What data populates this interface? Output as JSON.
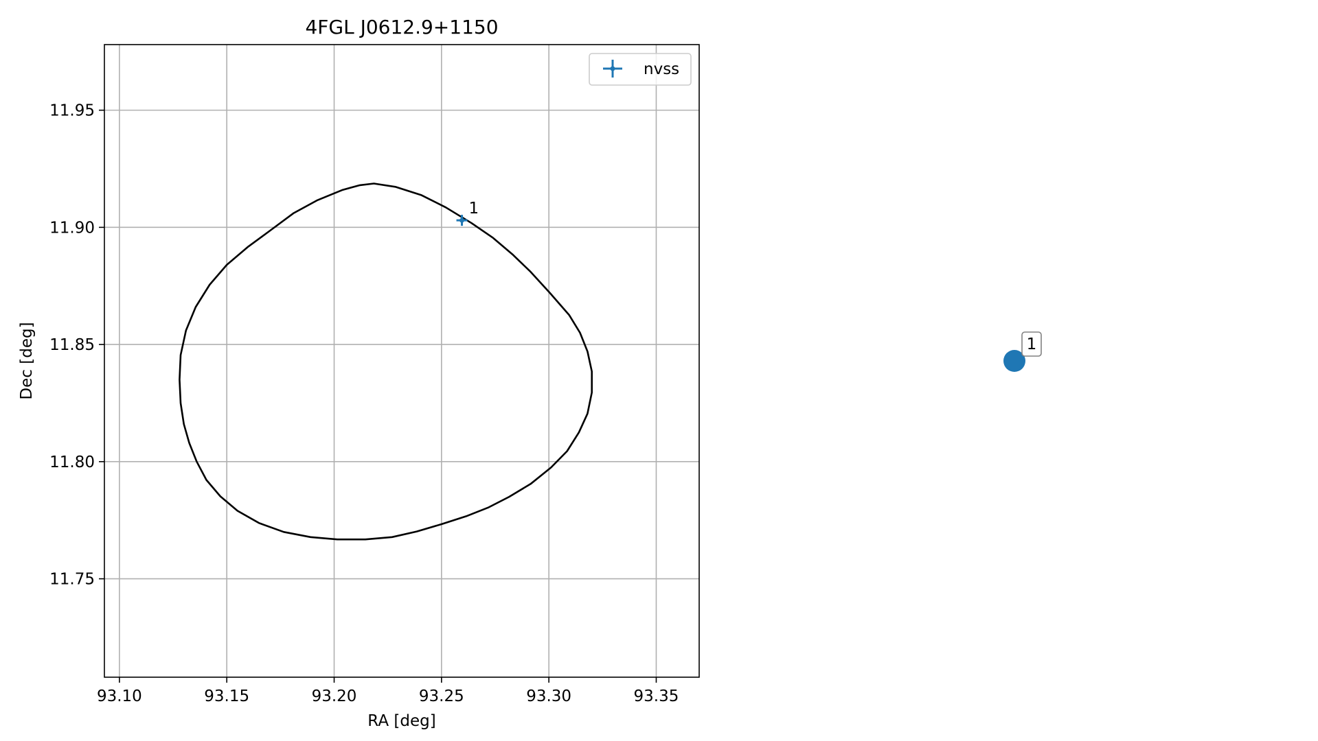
{
  "chart_data": [
    {
      "type": "scatter",
      "title": "4FGL J0612.9+1150",
      "xlabel": "RA [deg]",
      "ylabel": "Dec [deg]",
      "xlim": [
        93.093,
        93.37
      ],
      "ylim": [
        11.708,
        11.978
      ],
      "xticks": [
        93.1,
        93.15,
        93.2,
        93.25,
        93.3,
        93.35
      ],
      "xtick_labels": [
        "93.10",
        "93.15",
        "93.20",
        "93.25",
        "93.30",
        "93.35"
      ],
      "yticks": [
        11.75,
        11.8,
        11.85,
        11.9,
        11.95
      ],
      "ytick_labels": [
        "11.75",
        "11.80",
        "11.85",
        "11.90",
        "11.95"
      ],
      "grid": true,
      "legend": {
        "position": "top-right",
        "entries": [
          {
            "label": "nvss",
            "color": "#1f77b4",
            "marker": "errorbar-plus"
          }
        ]
      },
      "series": [
        {
          "name": "nvss",
          "color": "#1f77b4",
          "points": [
            {
              "x": 93.2595,
              "y": 11.903,
              "label": "1"
            }
          ]
        }
      ],
      "ellipse": {
        "color": "#000000",
        "points": [
          [
            93.2185,
            11.9187
          ],
          [
            93.2285,
            11.9173
          ],
          [
            93.2405,
            11.9138
          ],
          [
            93.252,
            11.9085
          ],
          [
            93.264,
            11.9018
          ],
          [
            93.274,
            11.8955
          ],
          [
            93.283,
            11.8885
          ],
          [
            93.2915,
            11.881
          ],
          [
            93.3005,
            11.872
          ],
          [
            93.3095,
            11.8625
          ],
          [
            93.3145,
            11.855
          ],
          [
            93.318,
            11.847
          ],
          [
            93.32,
            11.8385
          ],
          [
            93.32,
            11.8295
          ],
          [
            93.318,
            11.8205
          ],
          [
            93.314,
            11.8125
          ],
          [
            93.3085,
            11.8045
          ],
          [
            93.301,
            11.7975
          ],
          [
            93.2915,
            11.7905
          ],
          [
            93.2815,
            11.785
          ],
          [
            93.272,
            11.7805
          ],
          [
            93.2615,
            11.7767
          ],
          [
            93.25,
            11.7733
          ],
          [
            93.2385,
            11.7702
          ],
          [
            93.227,
            11.7678
          ],
          [
            93.2145,
            11.7668
          ],
          [
            93.2015,
            11.7668
          ],
          [
            93.189,
            11.7678
          ],
          [
            93.1765,
            11.77
          ],
          [
            93.165,
            11.7738
          ],
          [
            93.155,
            11.779
          ],
          [
            93.147,
            11.7852
          ],
          [
            93.1405,
            11.7922
          ],
          [
            93.136,
            11.8
          ],
          [
            93.1325,
            11.808
          ],
          [
            93.13,
            11.816
          ],
          [
            93.1285,
            11.825
          ],
          [
            93.128,
            11.835
          ],
          [
            93.1285,
            11.8455
          ],
          [
            93.131,
            11.856
          ],
          [
            93.1355,
            11.866
          ],
          [
            93.142,
            11.8755
          ],
          [
            93.15,
            11.884
          ],
          [
            93.16,
            11.8918
          ],
          [
            93.17,
            11.8985
          ],
          [
            93.181,
            11.906
          ],
          [
            93.192,
            11.9115
          ],
          [
            93.204,
            11.916
          ],
          [
            93.212,
            11.918
          ]
        ]
      }
    },
    {
      "type": "scatter",
      "series": [
        {
          "color": "#1f77b4",
          "points": [
            {
              "label": "1"
            }
          ]
        }
      ]
    }
  ]
}
